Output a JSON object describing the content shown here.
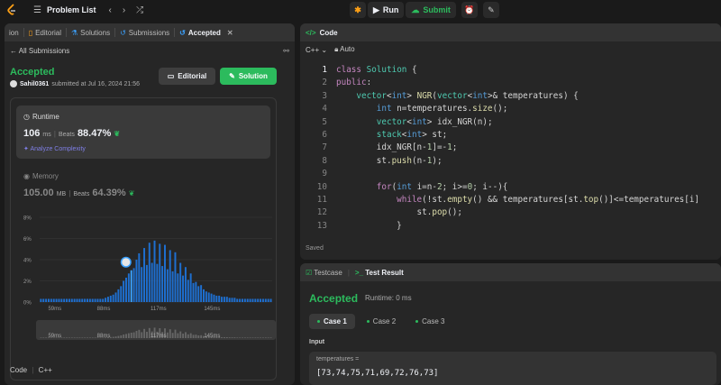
{
  "topbar": {
    "title": "Problem List",
    "run_label": "Run",
    "submit_label": "Submit"
  },
  "left_tabs": [
    {
      "label": "ion"
    },
    {
      "label": "Editorial"
    },
    {
      "label": "Solutions"
    },
    {
      "label": "Submissions"
    },
    {
      "label": "Accepted"
    }
  ],
  "submission": {
    "back_label": "All Submissions",
    "status": "Accepted",
    "user": "Sahil0361",
    "submitted_text": "submitted at Jul 16, 2024 21:56",
    "editorial_btn": "Editorial",
    "solution_btn": "Solution",
    "runtime_label": "Runtime",
    "runtime_value": "106",
    "runtime_unit": "ms",
    "beats_label": "Beats",
    "runtime_beats": "88.47%",
    "analyze": "Analyze Complexity",
    "memory_label": "Memory",
    "memory_value": "105.00",
    "memory_unit": "MB",
    "memory_beats": "64.39%",
    "code_label": "Code",
    "code_lang": "C++"
  },
  "chart_data": {
    "type": "bar",
    "title": "",
    "xlabel": "",
    "ylabel": "",
    "yticks": [
      "8%",
      "6%",
      "4%",
      "2%",
      "0%"
    ],
    "xticks": [
      "59ms",
      "88ms",
      "117ms",
      "145ms"
    ],
    "ylim": [
      0,
      8
    ],
    "highlight_bar_index": 35,
    "values": [
      0.3,
      0.3,
      0.3,
      0.3,
      0.3,
      0.3,
      0.3,
      0.3,
      0.3,
      0.3,
      0.3,
      0.3,
      0.3,
      0.3,
      0.3,
      0.3,
      0.3,
      0.3,
      0.3,
      0.3,
      0.3,
      0.3,
      0.3,
      0.3,
      0.3,
      0.4,
      0.5,
      0.6,
      0.7,
      0.9,
      1.2,
      1.5,
      2.0,
      2.3,
      2.7,
      3.0,
      3.2,
      4.0,
      4.6,
      3.3,
      5.1,
      3.5,
      5.6,
      3.7,
      5.8,
      3.6,
      5.5,
      3.4,
      5.4,
      3.1,
      4.9,
      2.9,
      4.7,
      2.7,
      3.7,
      2.5,
      3.3,
      2.1,
      2.7,
      1.8,
      1.9,
      1.5,
      1.6,
      1.2,
      1.0,
      0.9,
      0.8,
      0.7,
      0.6,
      0.6,
      0.5,
      0.5,
      0.5,
      0.4,
      0.4,
      0.4,
      0.3,
      0.3,
      0.3,
      0.3,
      0.3,
      0.3,
      0.3,
      0.3,
      0.3,
      0.3,
      0.3,
      0.3,
      0.3,
      0.3
    ],
    "minimap_xticks": [
      "59ms",
      "88ms",
      "117ms",
      "145ms"
    ]
  },
  "code_panel": {
    "title": "Code",
    "language": "C++",
    "auto": "Auto",
    "saved": "Saved",
    "lines": [
      "class Solution {",
      "public:",
      "    vector<int> NGR(vector<int>& temperatures) {",
      "        int n=temperatures.size();",
      "        vector<int> idx_NGR(n);",
      "        stack<int> st;",
      "        idx_NGR[n-1]=-1;",
      "        st.push(n-1);",
      "",
      "        for(int i=n-2; i>=0; i--){",
      "            while(!st.empty() && temperatures[st.top()]<=temperatures[i]",
      "                st.pop();",
      "            }"
    ]
  },
  "result_panel": {
    "tab_testcase": "Testcase",
    "tab_result": "Test Result",
    "status": "Accepted",
    "runtime": "Runtime: 0 ms",
    "cases": [
      "Case 1",
      "Case 2",
      "Case 3"
    ],
    "input_label": "Input",
    "param_name": "temperatures =",
    "param_value": "[73,74,75,71,69,72,76,73]"
  }
}
